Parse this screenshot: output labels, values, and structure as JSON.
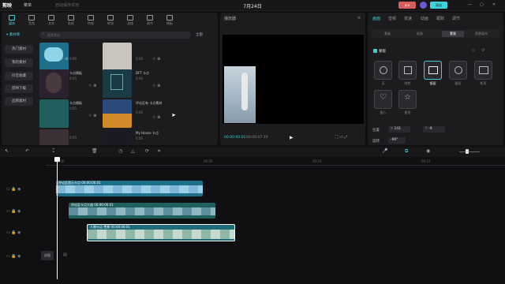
{
  "app": {
    "logo": "剪映",
    "menu": "菜单",
    "status": "自动保存本地",
    "title": "7月24日"
  },
  "topbar_right": {
    "pro_label": "pro",
    "export_label": "导出"
  },
  "categories": [
    {
      "label": "媒体",
      "active": true
    },
    {
      "label": "音频"
    },
    {
      "label": "文本"
    },
    {
      "label": "贴纸"
    },
    {
      "label": "特效"
    },
    {
      "label": "转场"
    },
    {
      "label": "滤镜"
    },
    {
      "label": "调节"
    },
    {
      "label": "模板"
    }
  ],
  "sidebar": {
    "items": [
      {
        "label": "▾ 素材库",
        "active": true
      },
      {
        "label": "热门素材"
      },
      {
        "label": "我的素材"
      },
      {
        "label": "抖音收藏"
      },
      {
        "label": "剪映下载"
      },
      {
        "label": "品牌素材"
      }
    ]
  },
  "search": {
    "placeholder": "搜索素材",
    "filter_label": "全部"
  },
  "tiles": [
    {
      "title": "",
      "duration": "0:06",
      "color": "#1d6f8a"
    },
    {
      "title": "",
      "duration": "0:06",
      "color": "#c9c4bc"
    },
    {
      "title": "",
      "duration": "",
      "color": "#1a1a1f"
    },
    {
      "title": "卡点模板",
      "duration": "0:05",
      "color": "#2b2230"
    },
    {
      "title": "DFT 卡点",
      "duration": "0:06",
      "color": "#1a3a44"
    },
    {
      "title": "",
      "duration": "",
      "color": "#1a1a1f"
    },
    {
      "title": "卡点模板",
      "duration": "0:05",
      "color": "#1f5f5e"
    },
    {
      "title": "评论区有 卡点素材",
      "duration": "0:06",
      "color": "#2a4a7a"
    },
    {
      "title": "",
      "duration": "",
      "color": "#1a1a1f"
    },
    {
      "title": "",
      "duration": "0:05",
      "color": "#3a3236"
    },
    {
      "title": "My House 卡点",
      "duration": "0:06",
      "color": "#1a1a22"
    },
    {
      "title": "",
      "duration": "",
      "color": "#1a1a1f"
    }
  ],
  "player": {
    "title": "播放器",
    "current_time": "00:00:00:01",
    "total_time": "00:00:07:10",
    "play_icon": "▶"
  },
  "right_panel": {
    "tabs": [
      {
        "label": "画面",
        "active": true
      },
      {
        "label": "音频"
      },
      {
        "label": "变速"
      },
      {
        "label": "动画"
      },
      {
        "label": "跟踪"
      },
      {
        "label": "调节"
      }
    ],
    "subtabs": [
      {
        "label": "基础"
      },
      {
        "label": "抠像"
      },
      {
        "label": "蒙版",
        "active": true
      },
      {
        "label": "背景填充"
      }
    ],
    "section_label": "蒙版",
    "masks": [
      {
        "label": "无"
      },
      {
        "label": "线性"
      },
      {
        "label": "镜面",
        "active": true
      },
      {
        "label": "圆形"
      },
      {
        "label": "矩形"
      },
      {
        "label": "爱心"
      },
      {
        "label": "星形"
      }
    ],
    "position_label": "位置",
    "x_label": "X",
    "x_value": "141",
    "y_label": "Y",
    "y_value": "-9",
    "rotate_label": "旋转",
    "rotate_value": "-90°"
  },
  "timeline": {
    "ruler_ticks": [
      "00:00",
      "00:05",
      "00:10",
      "00:15"
    ],
    "clips": [
      {
        "label": "评论区提示卡点 00:00:06:01",
        "color": "#1d6f8a"
      },
      {
        "label": "评论区卡点大道 00:00:06:01",
        "color": "#1f5f5e"
      },
      {
        "label": "人物卡点 雪景 00:00:06:01",
        "color": "#1e6c7a"
      }
    ],
    "cover_label": "封面"
  }
}
